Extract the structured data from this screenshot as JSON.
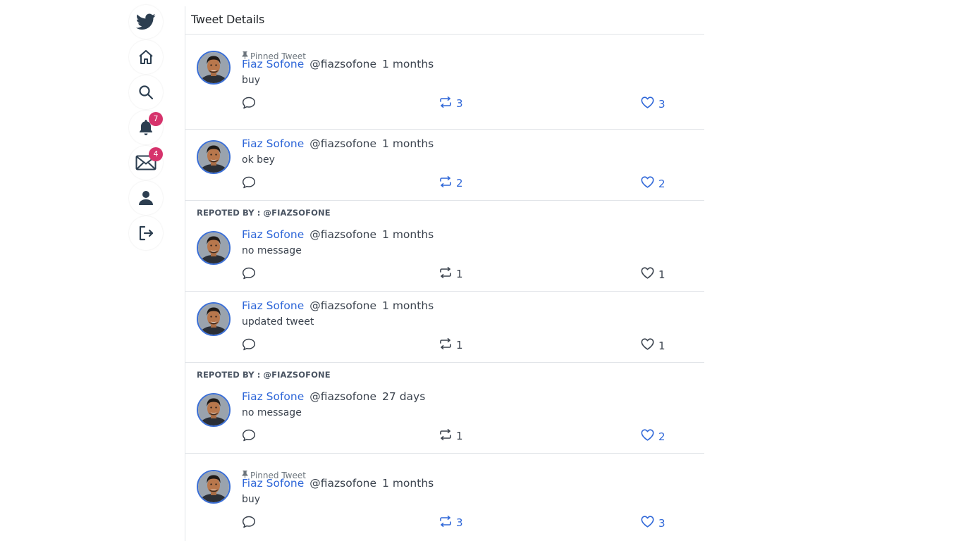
{
  "colors": {
    "brand": "#2f67d8",
    "badge": "#d6336c",
    "text": "#3a424d",
    "divider": "#e1e4e8"
  },
  "sidebar": {
    "items": [
      {
        "icon": "twitter-bird-icon",
        "label": ""
      },
      {
        "icon": "home-icon",
        "label": ""
      },
      {
        "icon": "search-icon",
        "label": ""
      },
      {
        "icon": "bell-icon",
        "badge": "7"
      },
      {
        "icon": "mail-icon",
        "badge": "4"
      },
      {
        "icon": "user-icon",
        "label": ""
      },
      {
        "icon": "logout-icon",
        "label": ""
      }
    ]
  },
  "header": {
    "title": "Tweet Details"
  },
  "tweets": [
    {
      "pinned": "Pinned Tweet",
      "reposted_by": "",
      "name": "Fiaz Sofone",
      "handle": "@fiazsofone",
      "time": "1 months",
      "text": "buy",
      "retweets": "3",
      "likes": "3",
      "retweeted": true,
      "liked": true
    },
    {
      "pinned": "",
      "reposted_by": "",
      "name": "Fiaz Sofone",
      "handle": "@fiazsofone",
      "time": "1 months",
      "text": "ok bey",
      "retweets": "2",
      "likes": "2",
      "retweeted": true,
      "liked": true
    },
    {
      "pinned": "",
      "reposted_by": "REPOTED BY : @FIAZSOFONE",
      "name": "Fiaz Sofone",
      "handle": "@fiazsofone",
      "time": "1 months",
      "text": "no message",
      "retweets": "1",
      "likes": "1",
      "retweeted": false,
      "liked": false
    },
    {
      "pinned": "",
      "reposted_by": "",
      "name": "Fiaz Sofone",
      "handle": "@fiazsofone",
      "time": "1 months",
      "text": "updated tweet",
      "retweets": "1",
      "likes": "1",
      "retweeted": false,
      "liked": false
    },
    {
      "pinned": "",
      "reposted_by": "REPOTED BY : @FIAZSOFONE",
      "name": "Fiaz Sofone",
      "handle": "@fiazsofone",
      "time": "27 days",
      "text": "no message",
      "retweets": "1",
      "likes": "2",
      "retweeted": false,
      "liked": true
    },
    {
      "pinned": "Pinned Tweet",
      "reposted_by": "",
      "name": "Fiaz Sofone",
      "handle": "@fiazsofone",
      "time": "1 months",
      "text": "buy",
      "retweets": "3",
      "likes": "3",
      "retweeted": true,
      "liked": true
    }
  ]
}
